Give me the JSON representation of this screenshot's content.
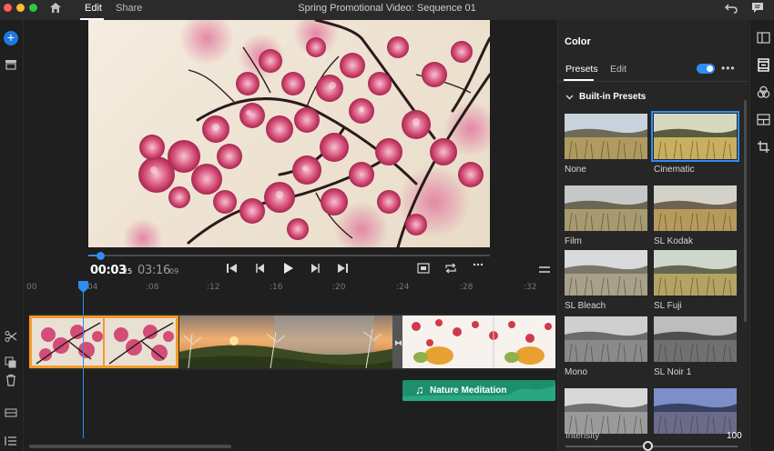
{
  "titlebar": {
    "tabs": [
      "Edit",
      "Share"
    ],
    "window_title": "Spring Promotional Video: Sequence 01"
  },
  "player": {
    "current_time": "00:03",
    "current_frames": "25",
    "total_time": "03:16",
    "total_frames": "09",
    "progress_fraction": 0.03
  },
  "ruler": {
    "ticks": [
      "00",
      "04",
      ":08",
      ":12",
      ":16",
      ":20",
      ":24",
      ":28",
      ":32"
    ]
  },
  "audio": {
    "title": "Nature Meditation"
  },
  "color_panel": {
    "title": "Color",
    "tabs": [
      "Presets",
      "Edit"
    ],
    "toggle_on": true,
    "section": "Built-in Presets",
    "presets": [
      {
        "name": "None",
        "style": "none"
      },
      {
        "name": "Cinematic",
        "style": "cinematic",
        "selected": true
      },
      {
        "name": "Film",
        "style": "film"
      },
      {
        "name": "SL Kodak",
        "style": "kodak"
      },
      {
        "name": "SL Bleach",
        "style": "bleach"
      },
      {
        "name": "SL Fuji",
        "style": "fuji"
      },
      {
        "name": "Mono",
        "style": "mono"
      },
      {
        "name": "SL Noir 1",
        "style": "noir"
      },
      {
        "name": "",
        "style": "mono2"
      },
      {
        "name": "",
        "style": "blue"
      }
    ],
    "intensity_label": "Intensity",
    "intensity_value": "100",
    "intensity_fraction": 0.48
  },
  "colors": {
    "accent": "#2f8cf0",
    "selected_clip": "#f39a2b",
    "audio_clip": "#1d8f6c"
  }
}
